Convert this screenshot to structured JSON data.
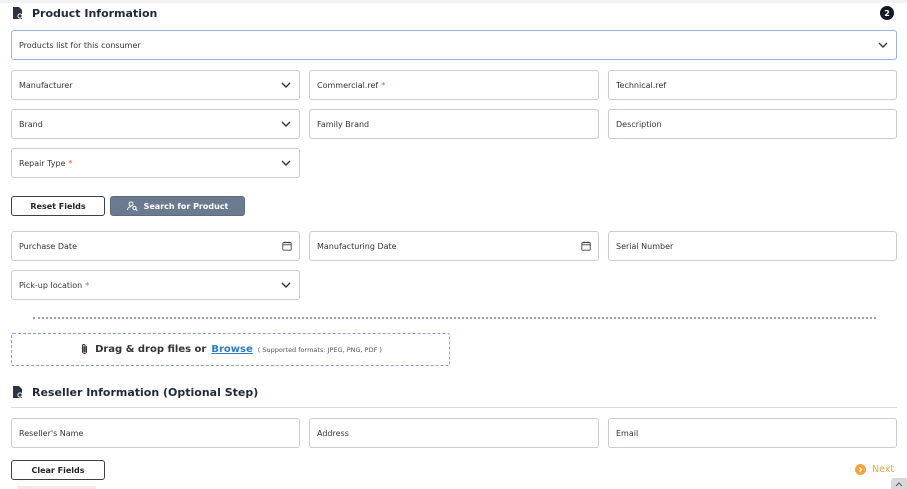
{
  "product_section": {
    "title": "Product Information",
    "step_number": "2",
    "products_list_placeholder": "Products list for this consumer",
    "manufacturer": "Manufacturer",
    "commercial_ref": "Commercial.ref",
    "technical_ref": "Technical.ref",
    "brand": "Brand",
    "family_brand": "Family Brand",
    "description": "Description",
    "repair_type": "Repair Type",
    "reset_button": "Reset Fields",
    "search_button": "Search for Product",
    "purchase_date": "Purchase Date",
    "manufacturing_date": "Manufacturing Date",
    "serial_number": "Serial Number",
    "pickup_location": "Pick-up location",
    "required_mark": "*"
  },
  "upload": {
    "text": "Drag & drop files or",
    "browse": "Browse",
    "formats": "( Supported formats: JPEG, PNG, PDF )"
  },
  "reseller_section": {
    "title": "Reseller Information (Optional Step)",
    "name": "Reseller's Name",
    "address": "Address",
    "email": "Email",
    "clear_button": "Clear Fields"
  },
  "footer": {
    "next_label": "Next"
  },
  "colors": {
    "accent_orange": "#f2a640",
    "required_red": "#e0562f",
    "search_button_bg": "#6b7a8f",
    "link_blue": "#2e7bc4"
  },
  "icons": {
    "section_icon": "document-gear-icon",
    "search_icon": "user-search-icon",
    "attachment_icon": "paperclip-icon",
    "calendar_icon": "calendar-icon",
    "dropdown_icon": "chevron-down-icon",
    "next_icon": "chevron-right-circle-icon",
    "scroll_icon": "chevron-up-icon"
  }
}
